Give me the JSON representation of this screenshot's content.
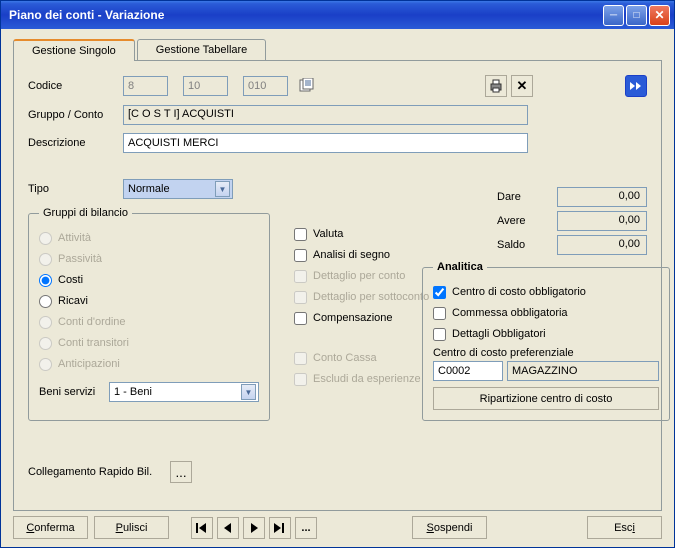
{
  "titlebar": {
    "title": "Piano dei conti - Variazione"
  },
  "tabs": {
    "t0": "Gestione Singolo",
    "t1": "Gestione Tabellare"
  },
  "labels": {
    "codice": "Codice",
    "gruppo": "Gruppo / Conto",
    "descr": "Descrizione",
    "tipo": "Tipo",
    "beni": "Beni servizi",
    "colleg": "Collegamento Rapido Bil.",
    "dare": "Dare",
    "avere": "Avere",
    "saldo": "Saldo",
    "ccopref": "Centro di costo preferenziale"
  },
  "codice": {
    "v1": "8",
    "v2": "10",
    "v3": "010"
  },
  "gruppo": "[C O S T I]  ACQUISTI",
  "descr": "ACQUISTI MERCI",
  "tipo": "Normale",
  "gruppi_bilancio": {
    "legend": "Gruppi di bilancio",
    "attivita": "Attività",
    "passivita": "Passività",
    "costi": "Costi",
    "ricavi": "Ricavi",
    "ordine": "Conti d'ordine",
    "transitori": "Conti transitori",
    "anticipazioni": "Anticipazioni"
  },
  "beni": "1 - Beni",
  "checks": {
    "valuta": "Valuta",
    "analisi": "Analisi di segno",
    "dett_conto": "Dettaglio per conto",
    "dett_sotto": "Dettaglio per sottoconto",
    "compens": "Compensazione",
    "cassa": "Conto Cassa",
    "escludi": "Escludi da esperienze"
  },
  "amounts": {
    "dare": "0,00",
    "avere": "0,00",
    "saldo": "0,00"
  },
  "analitica": {
    "legend": "Analitica",
    "cco_obb": "Centro di costo obbligatorio",
    "comm_obb": "Commessa obbligatoria",
    "dett_obb": "Dettagli Obbligatori",
    "code": "C0002",
    "desc": "MAGAZZINO",
    "ripart": "Ripartizione centro di costo"
  },
  "footer": {
    "conferma": "Conferma",
    "pulisci": "Pulisci",
    "sospendi": "Sospendi",
    "esci": "Esci"
  }
}
